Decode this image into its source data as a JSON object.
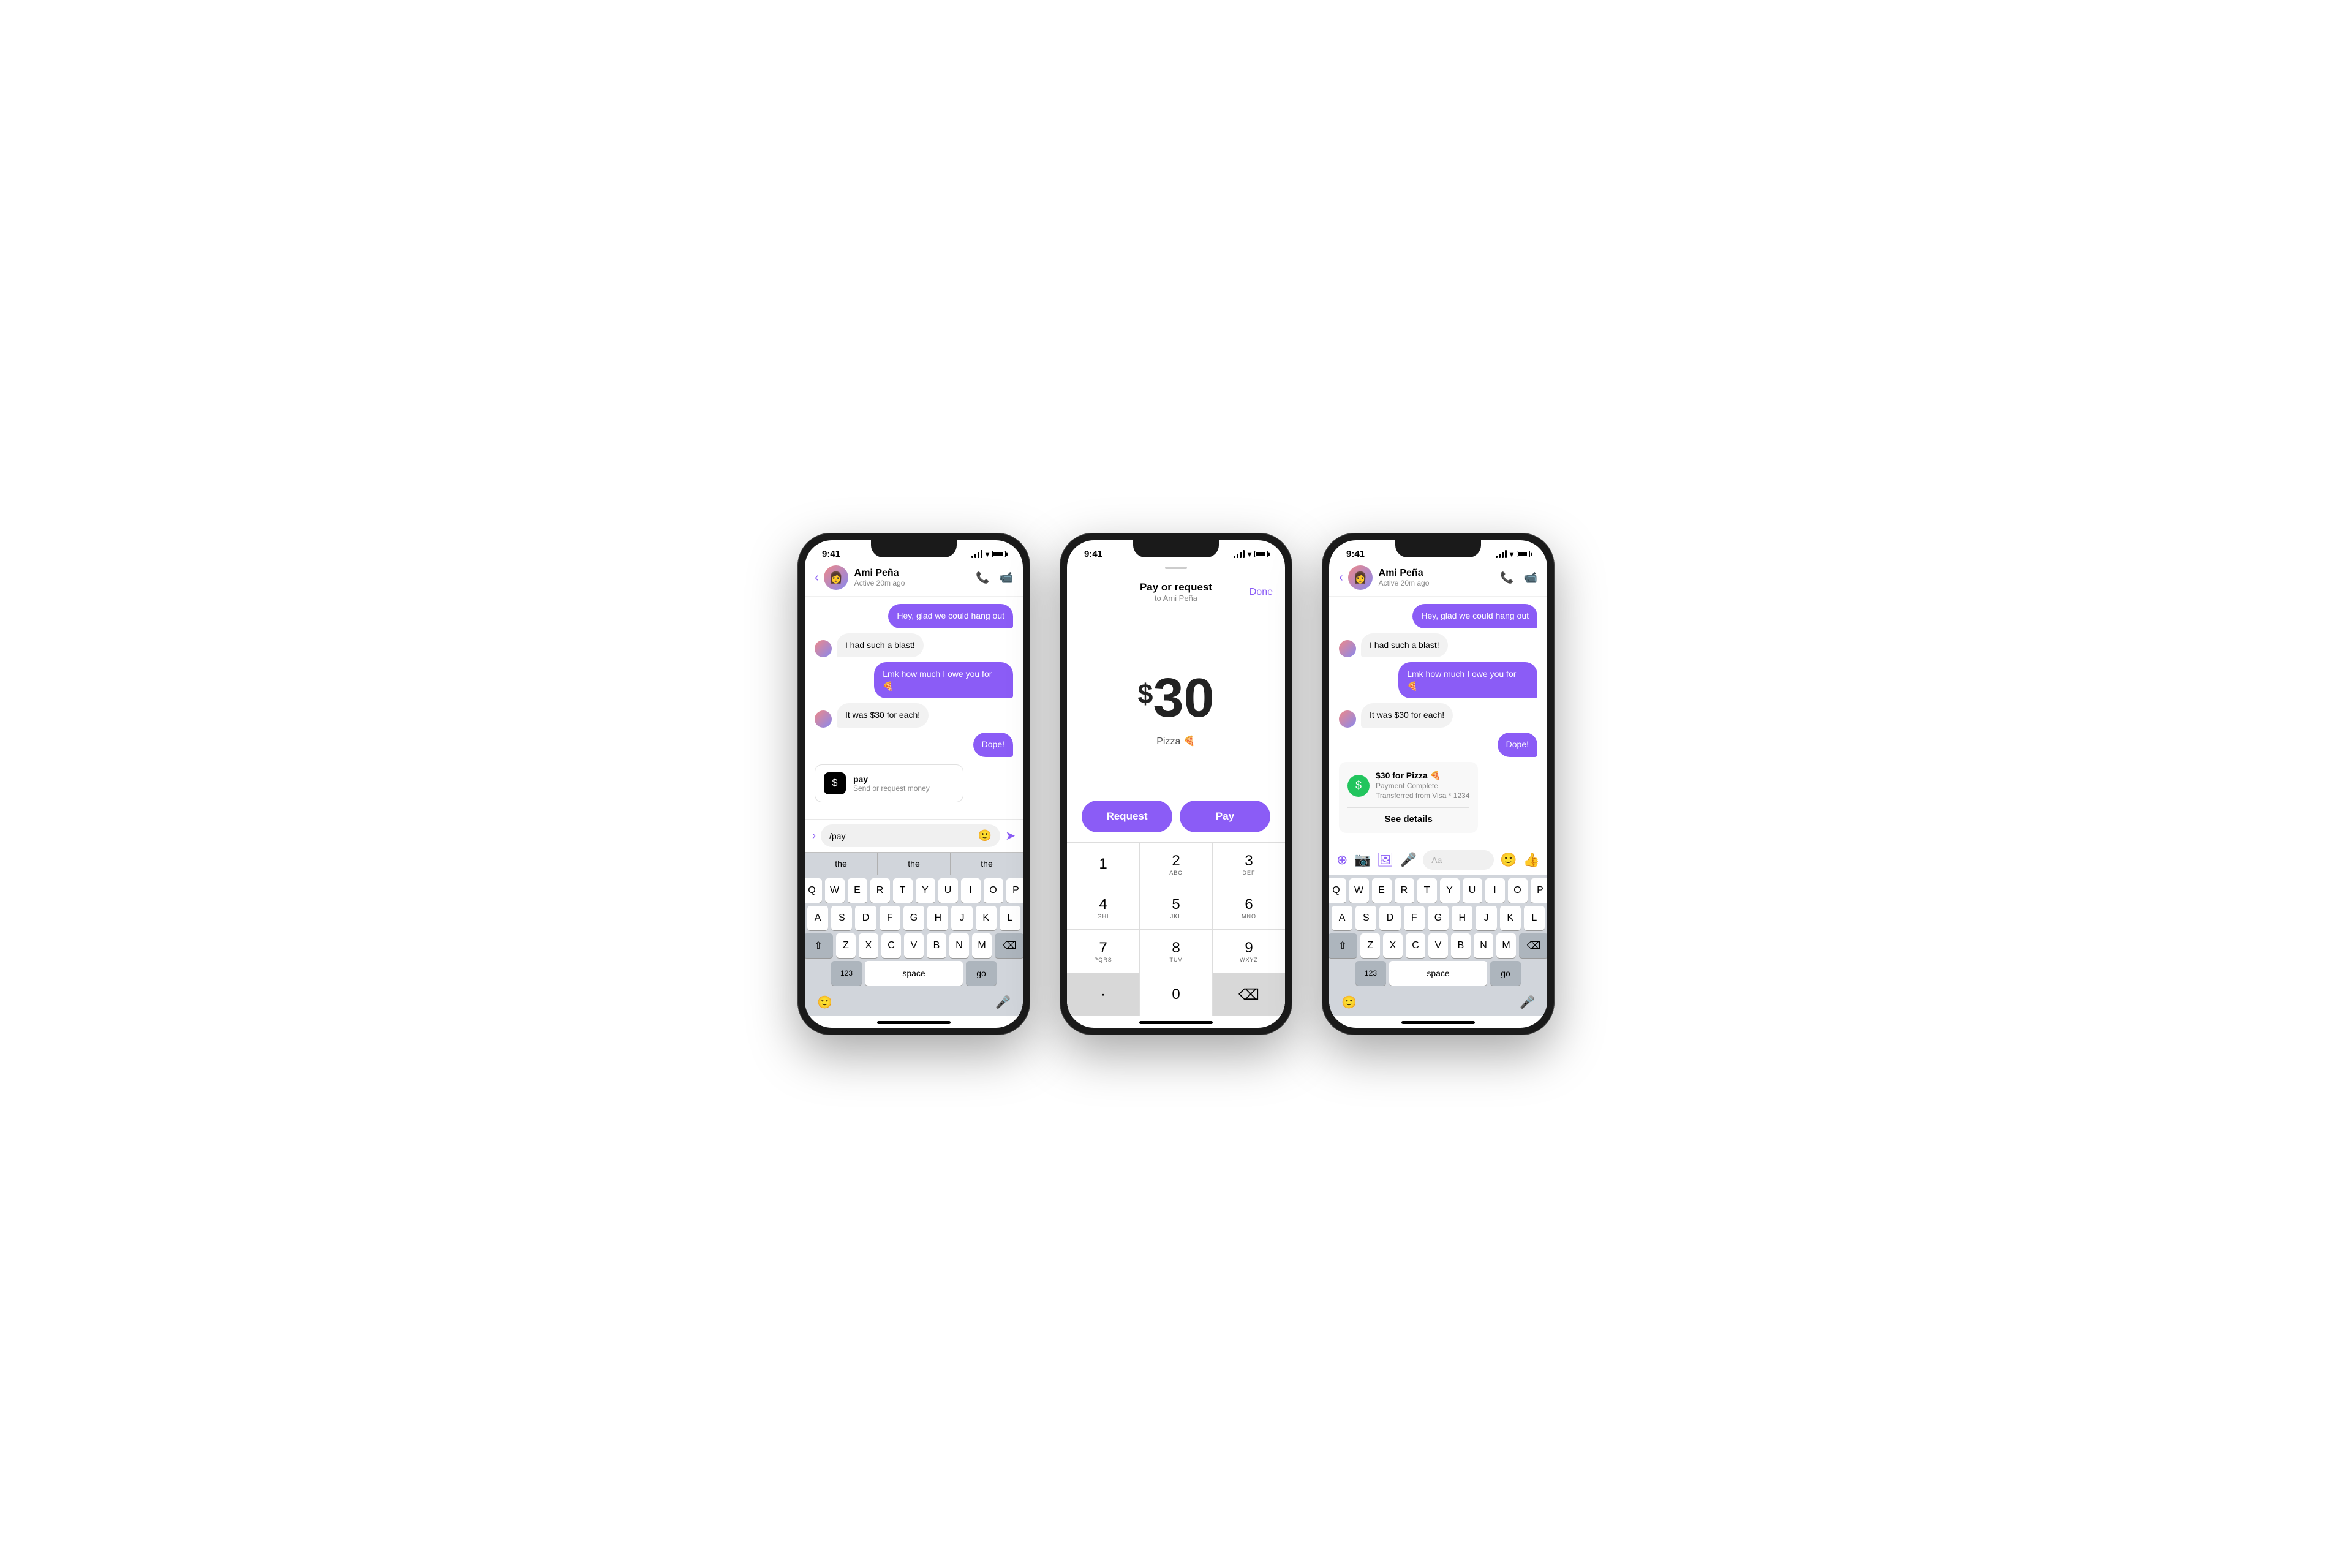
{
  "phones": [
    {
      "id": "phone1",
      "statusBar": {
        "time": "9:41"
      },
      "header": {
        "name": "Ami Peña",
        "status": "Active 20m ago"
      },
      "messages": [
        {
          "type": "sent",
          "text": "Hey, glad we could hang out"
        },
        {
          "type": "received",
          "text": "I had such a blast!"
        },
        {
          "type": "sent",
          "text": "Lmk how much I owe you for 🍕"
        },
        {
          "type": "received",
          "text": "It was $30 for each!"
        },
        {
          "type": "sent",
          "text": "Dope!"
        }
      ],
      "payCard": {
        "title": "pay",
        "subtitle": "Send or request money"
      },
      "inputValue": "/pay",
      "suggestions": [
        "the",
        "the",
        "the"
      ],
      "keyboard": {
        "rows": [
          [
            "Q",
            "W",
            "E",
            "R",
            "T",
            "Y",
            "U",
            "I",
            "O",
            "P"
          ],
          [
            "A",
            "S",
            "D",
            "F",
            "G",
            "H",
            "J",
            "K",
            "L"
          ],
          [
            "⇧",
            "Z",
            "X",
            "C",
            "V",
            "B",
            "N",
            "M",
            "⌫"
          ],
          [
            "123",
            "space",
            "go"
          ]
        ]
      }
    },
    {
      "id": "phone2",
      "statusBar": {
        "time": "9:41"
      },
      "payScreen": {
        "title": "Pay or request",
        "subtitle": "to Ami Peña",
        "doneLabel": "Done",
        "amount": "30",
        "dollarSign": "$",
        "label": "Pizza 🍕",
        "requestBtn": "Request",
        "payBtn": "Pay"
      },
      "numpad": {
        "rows": [
          [
            {
              "digit": "1",
              "letters": ""
            },
            {
              "digit": "2",
              "letters": "ABC"
            },
            {
              "digit": "3",
              "letters": "DEF"
            }
          ],
          [
            {
              "digit": "4",
              "letters": "GHI"
            },
            {
              "digit": "5",
              "letters": "JKL"
            },
            {
              "digit": "6",
              "letters": "MNO"
            }
          ],
          [
            {
              "digit": "7",
              "letters": "PQRS"
            },
            {
              "digit": "8",
              "letters": "TUV"
            },
            {
              "digit": "9",
              "letters": "WXYZ"
            }
          ],
          [
            {
              "digit": "·",
              "letters": "",
              "gray": false
            },
            {
              "digit": "0",
              "letters": ""
            },
            {
              "digit": "⌫",
              "letters": "",
              "gray": true
            }
          ]
        ]
      }
    },
    {
      "id": "phone3",
      "statusBar": {
        "time": "9:41"
      },
      "header": {
        "name": "Ami Peña",
        "status": "Active 20m ago"
      },
      "messages": [
        {
          "type": "sent",
          "text": "Hey, glad we could hang out"
        },
        {
          "type": "received",
          "text": "I had such a blast!"
        },
        {
          "type": "sent",
          "text": "Lmk how much I owe you for 🍕"
        },
        {
          "type": "received",
          "text": "It was $30 for each!"
        },
        {
          "type": "sent",
          "text": "Dope!"
        }
      ],
      "paymentCard": {
        "amount": "$30 for Pizza 🍕",
        "status": "Payment Complete",
        "transfer": "Transferred from Visa * 1234",
        "detailsLabel": "See details"
      },
      "inputPlaceholder": "Aa",
      "keyboard": {
        "rows": [
          [
            "Q",
            "W",
            "E",
            "R",
            "T",
            "Y",
            "U",
            "I",
            "O",
            "P"
          ],
          [
            "A",
            "S",
            "D",
            "F",
            "G",
            "H",
            "J",
            "K",
            "L"
          ],
          [
            "⇧",
            "Z",
            "X",
            "C",
            "V",
            "B",
            "N",
            "M",
            "⌫"
          ],
          [
            "123",
            "space",
            "go"
          ]
        ]
      }
    }
  ]
}
